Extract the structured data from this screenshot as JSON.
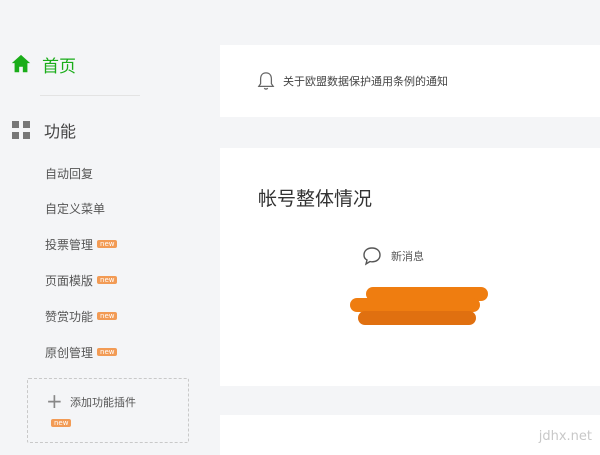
{
  "sidebar": {
    "home": {
      "label": "首页",
      "icon": "home-icon"
    },
    "group": {
      "label": "功能",
      "icon": "grid-icon"
    },
    "items": [
      {
        "label": "自动回复",
        "badge": ""
      },
      {
        "label": "自定义菜单",
        "badge": ""
      },
      {
        "label": "投票管理",
        "badge": "new"
      },
      {
        "label": "页面模版",
        "badge": "new"
      },
      {
        "label": "赞赏功能",
        "badge": "new"
      },
      {
        "label": "原创管理",
        "badge": "new"
      }
    ],
    "add_plugin": {
      "label": "添加功能插件",
      "badge": "new"
    }
  },
  "notice": {
    "text": "关于欧盟数据保护通用条例的通知",
    "icon": "bell-icon"
  },
  "overview": {
    "title": "帐号整体情况",
    "new_messages_label": "新消息",
    "new_messages_icon": "chat-bubble-icon"
  },
  "watermark": "jdhx.net",
  "colors": {
    "accent": "#1aad19",
    "badge": "#f29b55",
    "redaction": "#ef7d10"
  }
}
